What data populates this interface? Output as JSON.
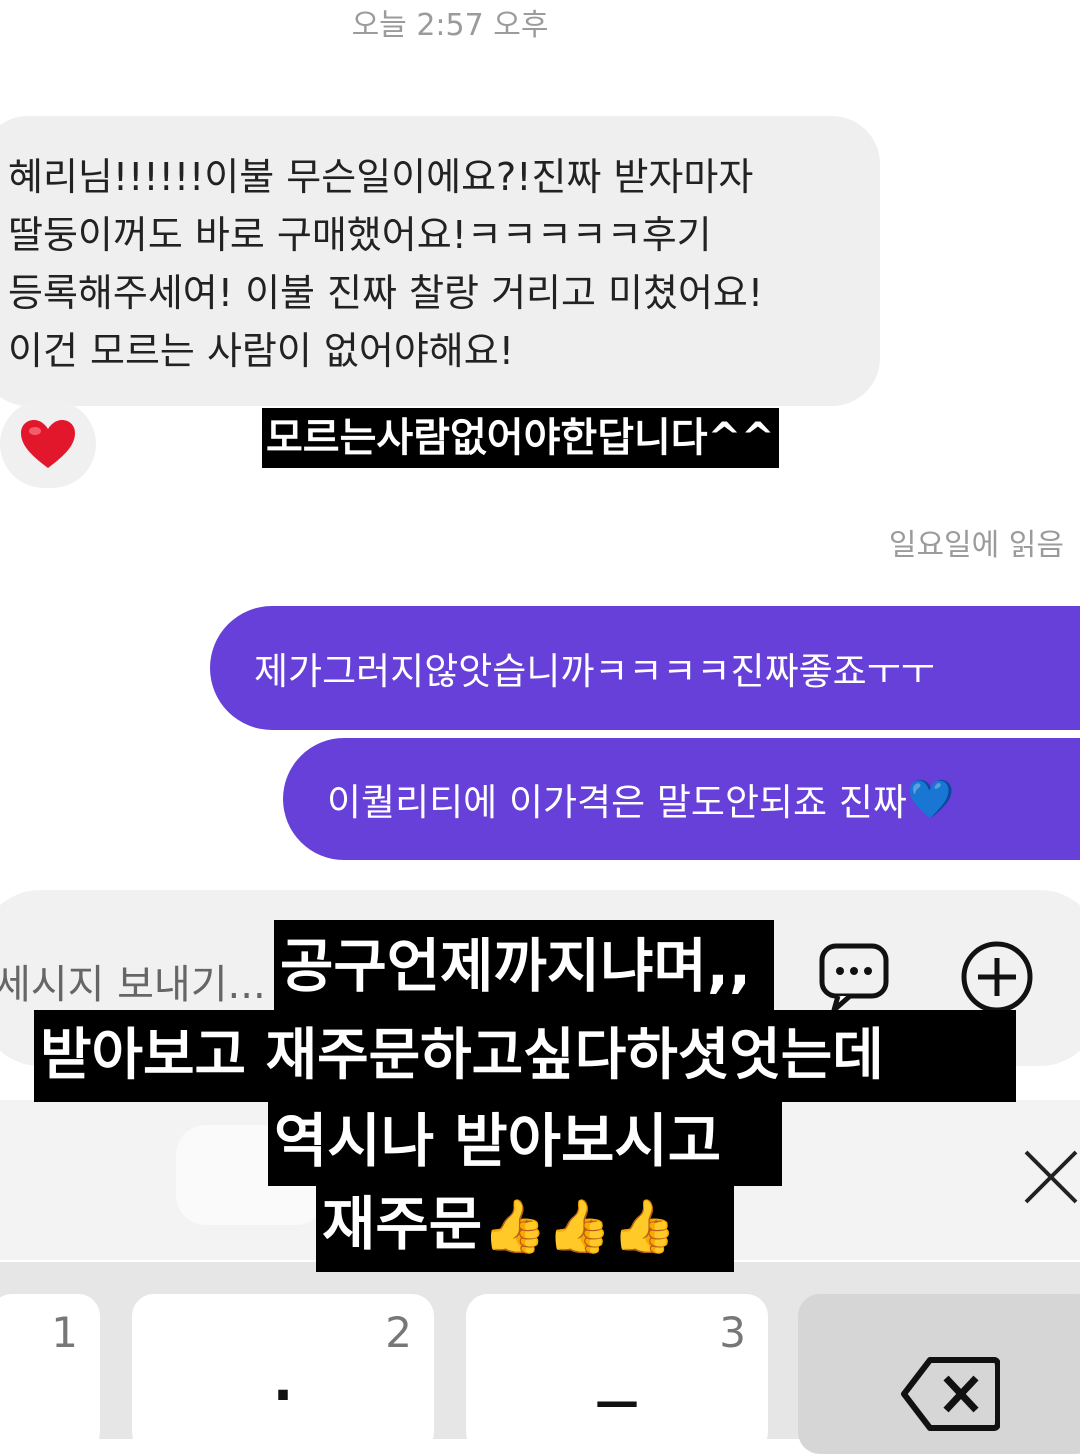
{
  "header": {
    "timestamp": "오늘 2:57 오후"
  },
  "incoming_message": {
    "lines": [
      "혜리님!!!!!!이불 무슨일이에요?!진짜 받자마자",
      "딸둥이꺼도 바로 구매했어요!ㅋㅋㅋㅋㅋ후기",
      "등록해주세여! 이불 진짜 찰랑 거리고 미쳤어요!",
      "이건 모르는 사람이 없어야해요!"
    ],
    "reaction_icon": "red-heart-icon"
  },
  "overlay_caption_top": "모르는사람없어야한답니다^^",
  "read_status": "일요일에 읽음",
  "outgoing_messages": [
    {
      "text": "제가그러지않앗습니까ㅋㅋㅋㅋ진짜좋죠ㅜㅜ"
    },
    {
      "text": "이퀄리티에 이가격은 말도안되죠 진짜",
      "emoji": "💙"
    }
  ],
  "composer": {
    "placeholder": "세시지 보내기...",
    "buttons": [
      "chat-bubble-icon",
      "plus-circle-icon"
    ]
  },
  "overlay_caption_bottom": {
    "lines": [
      "공구언제까지냐며,,",
      "받아보고  재주문하고싶다하셧엇는데",
      "역시나  받아보시고",
      "재주문"
    ],
    "emoji": "👍👍👍"
  },
  "panel": {
    "close_icon": "close-x-icon"
  },
  "keyboard": {
    "keys": [
      {
        "num": "1",
        "sym": ""
      },
      {
        "num": "2",
        "sym": "·"
      },
      {
        "num": "3",
        "sym": "—"
      },
      {
        "num": "",
        "sym": "backspace-icon"
      }
    ]
  }
}
